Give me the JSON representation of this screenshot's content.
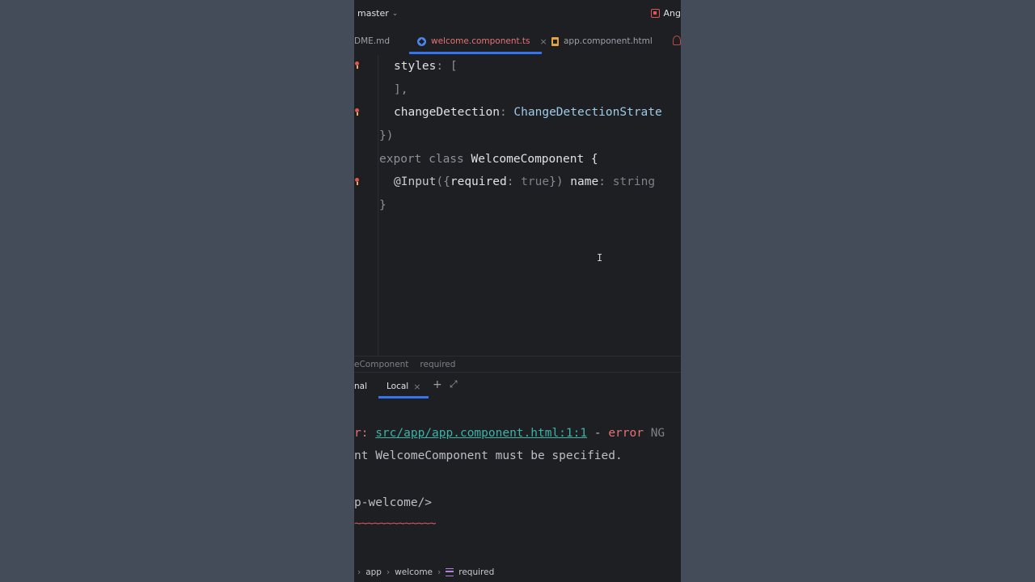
{
  "topbar": {
    "branch": "master",
    "project": "Ang"
  },
  "tabs": [
    {
      "label": "DME.md"
    },
    {
      "label": "welcome.component.ts",
      "active": true
    },
    {
      "label": "app.component.html"
    }
  ],
  "code": {
    "l1_prop": "styles",
    "l1_rest": ": [",
    "l2": "],",
    "l3_prop": "changeDetection",
    "l3_colon": ": ",
    "l3_type": "ChangeDetectionStrate",
    "l4": "})",
    "l5_kw": "export class ",
    "l5_cls": "WelcomeComponent",
    "l5_brace": " {",
    "l6_dec": "@Input",
    "l6_p1": "({",
    "l6_req": "required",
    "l6_colon": ": ",
    "l6_true": "true",
    "l6_p2": "}) ",
    "l6_name": "name",
    "l6_colon2": ": ",
    "l6_type": "string",
    "l7": "}"
  },
  "breadcrumb": {
    "item1": "eComponent",
    "item2": "required"
  },
  "terminal_tabs": {
    "first": "nal",
    "local": "Local",
    "close": "×"
  },
  "terminal": {
    "l1_prefix": "r: ",
    "l1_link": "src/app/app.component.html:1:1",
    "l1_sep": " - ",
    "l1_err": "error",
    "l1_code": " NG",
    "l2": "nt WelcomeComponent must be specified.",
    "l3": "p-welcome/>",
    "l4": "~~~~~~~~~~~~~"
  },
  "status": {
    "p1": "app",
    "p2": "welcome",
    "p3": "required"
  }
}
